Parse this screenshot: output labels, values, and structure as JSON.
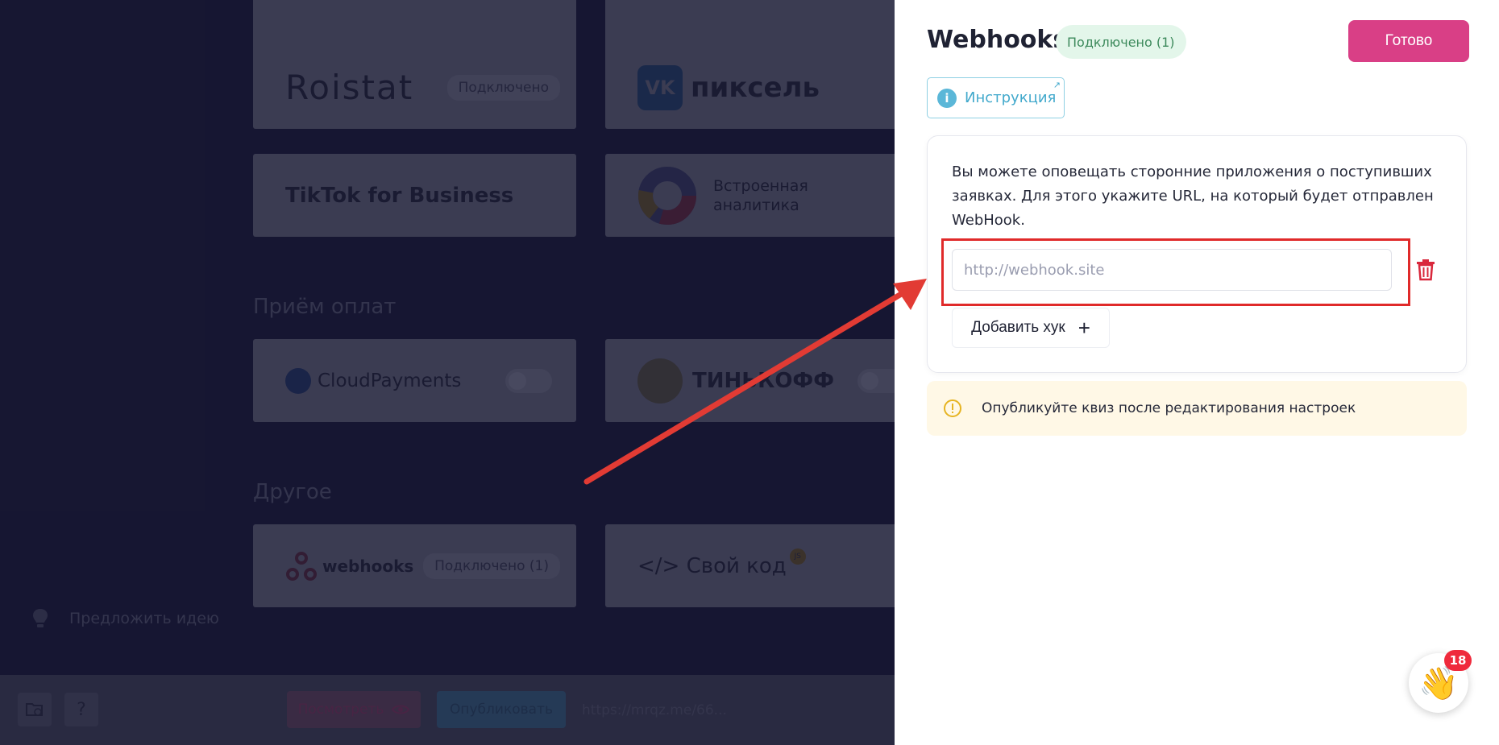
{
  "background": {
    "cards": [
      {
        "logo": "Roistat",
        "badge": "Подключено"
      },
      {
        "logo": "пиксель"
      },
      {
        "logo": "TikTok for Business"
      },
      {
        "logo": "Встроенная аналитика"
      },
      {
        "logo": "CloudPayments"
      },
      {
        "logo": "ТИНЬКОФФ"
      },
      {
        "logo": "webhooks",
        "badge": "Подключено (1)"
      },
      {
        "logo": "</> Свой код",
        "tag": "JS"
      }
    ],
    "sections": {
      "payments": "Приём оплат",
      "other": "Другое"
    },
    "suggest_label": "Предложить идею",
    "bottom_bar": {
      "help": "?",
      "preview_label": "Посмотреть",
      "publish_label": "Опубликовать",
      "url": "https://mrqz.me/66..."
    }
  },
  "panel": {
    "title": "Webhooks",
    "badge": "Подключено (1)",
    "done_label": "Готово",
    "instruction_label": "Инструкция",
    "description": "Вы можете оповещать сторонние приложения о поступивших заявках. Для этого укажите URL, на который будет отправлен WebHook.",
    "input_placeholder": "http://webhook.site",
    "add_label": "Добавить хук",
    "warning": "Опубликуйте квиз после редактирования настроек"
  },
  "notifications": {
    "count": "18"
  },
  "colors": {
    "accent": "#d93f86",
    "highlight": "#e02a2a",
    "info": "#42a9cc",
    "success_bg": "#e3f6ea"
  }
}
